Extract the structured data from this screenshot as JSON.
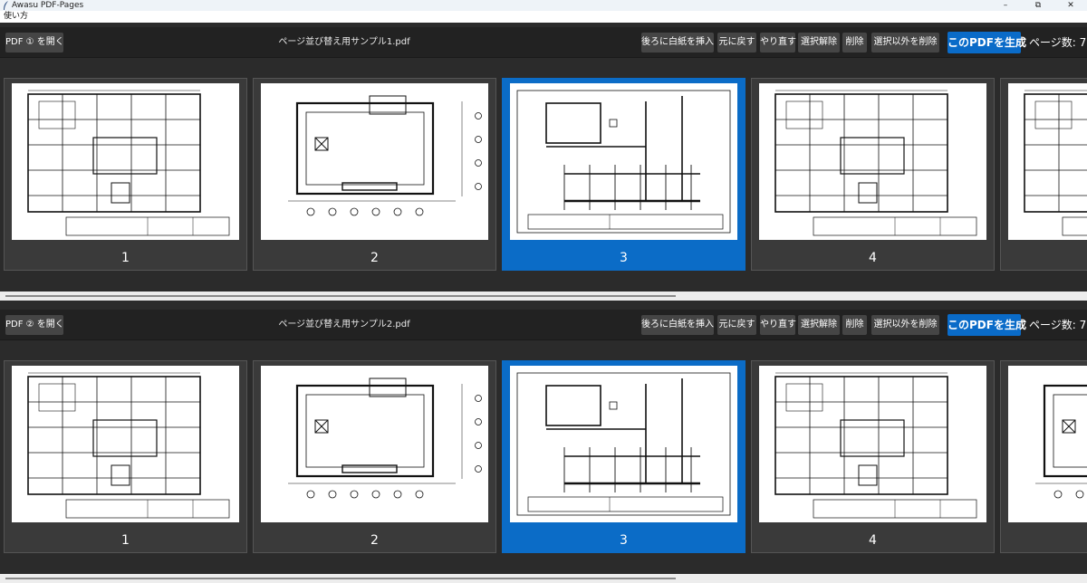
{
  "window": {
    "title": "Awasu PDF-Pages",
    "minimize": "–",
    "maximize": "⧉",
    "close": "✕"
  },
  "menu": {
    "help": "使い方"
  },
  "common": {
    "insert_blank": "後ろに白紙を挿入",
    "undo": "元に戻す",
    "redo": "やり直す",
    "deselect": "選択解除",
    "delete": "削除",
    "delete_others": "選択以外を削除",
    "generate": "このPDFを生成"
  },
  "panels": [
    {
      "open_button": "PDF ① を開く",
      "filename": "ページ並び替え用サンプル1.pdf",
      "page_count": "ページ数: 7",
      "pages": [
        {
          "label": "1",
          "selected": false,
          "plan": "a"
        },
        {
          "label": "2",
          "selected": false,
          "plan": "b"
        },
        {
          "label": "3",
          "selected": true,
          "plan": "c"
        },
        {
          "label": "4",
          "selected": false,
          "plan": "a"
        },
        {
          "label": "",
          "selected": false,
          "plan": "a"
        }
      ]
    },
    {
      "open_button": "PDF ② を開く",
      "filename": "ページ並び替え用サンプル2.pdf",
      "page_count": "ページ数: 7",
      "pages": [
        {
          "label": "1",
          "selected": false,
          "plan": "a"
        },
        {
          "label": "2",
          "selected": false,
          "plan": "b"
        },
        {
          "label": "3",
          "selected": true,
          "plan": "c"
        },
        {
          "label": "4",
          "selected": false,
          "plan": "a"
        },
        {
          "label": "",
          "selected": false,
          "plan": "b"
        }
      ]
    }
  ],
  "colors": {
    "accent": "#0b6cc7",
    "toolbar": "#222222",
    "background": "#2b2b2b",
    "button": "#454545"
  }
}
